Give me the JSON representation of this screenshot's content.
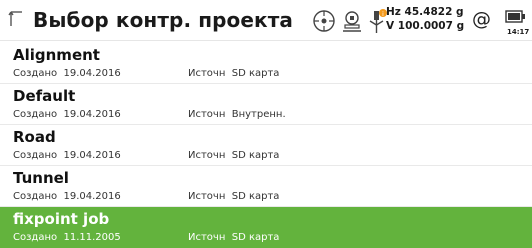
{
  "header": {
    "title": "Выбор контр. проекта",
    "hz": "Hz 45.4822 g",
    "v": "V  100.0007 g",
    "at_symbol": "@",
    "time": "14:17",
    "icons": [
      "back-icon",
      "target-icon",
      "instrument-icon",
      "prism-pole-icon",
      "at-icon",
      "battery-icon"
    ],
    "colors": {
      "notification": "#f39a1e",
      "selection": "#63b33d"
    }
  },
  "jobs": [
    {
      "name": "Alignment",
      "created_label": "Создано",
      "created_date": "19.04.2016",
      "source_label": "Источн",
      "source_value": "SD карта"
    },
    {
      "name": "Default",
      "created_label": "Создано",
      "created_date": "19.04.2016",
      "source_label": "Источн",
      "source_value": "Внутренн."
    },
    {
      "name": "Road",
      "created_label": "Создано",
      "created_date": "19.04.2016",
      "source_label": "Источн",
      "source_value": "SD карта"
    },
    {
      "name": "Tunnel",
      "created_label": "Создано",
      "created_date": "19.04.2016",
      "source_label": "Источн",
      "source_value": "SD карта"
    },
    {
      "name": "fixpoint job",
      "created_label": "Создано",
      "created_date": "11.11.2005",
      "source_label": "Источн",
      "source_value": "SD карта",
      "selected": true
    }
  ]
}
